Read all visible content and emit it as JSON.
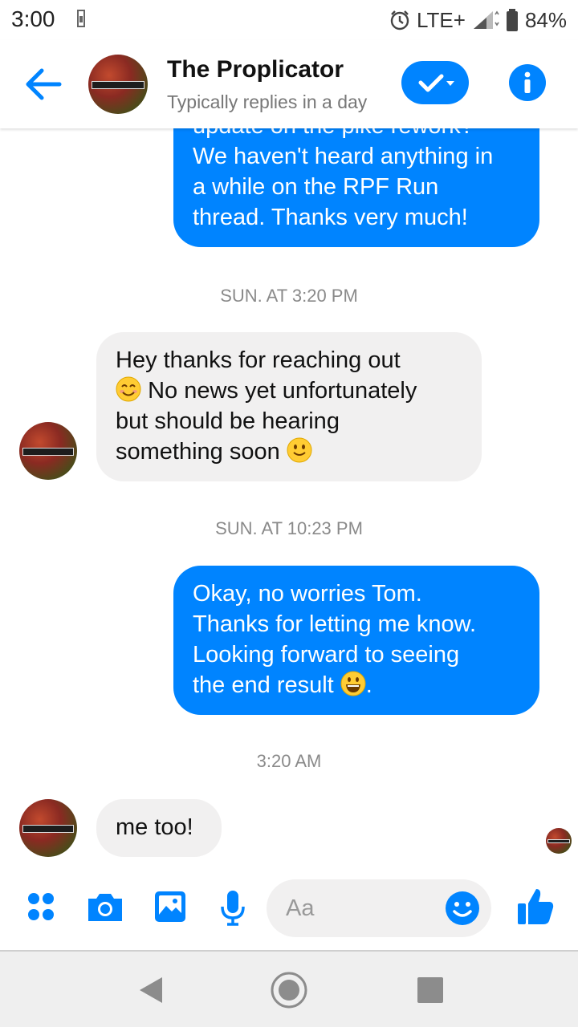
{
  "status_bar": {
    "time": "3:00",
    "network": "LTE+",
    "battery": "84%",
    "icons": [
      "sim-icon",
      "alarm-icon",
      "signal-icon",
      "battery-icon"
    ]
  },
  "header": {
    "title": "The Proplicator",
    "subtitle": "Typically replies in a day",
    "back_icon": "arrow-left-icon",
    "check_icon": "check-dropdown-icon",
    "info_icon": "info-icon",
    "avatar_text": "THE PROPLICATOR"
  },
  "messages": [
    {
      "direction": "outgoing",
      "lines": [
        "update on the pike rework?",
        "We haven't heard anything in",
        "a while on the RPF Run",
        "thread. Thanks very much!"
      ]
    },
    {
      "type": "timestamp",
      "text": "SUN. AT 3:20 PM"
    },
    {
      "direction": "incoming",
      "lines": [
        "Hey thanks for reaching out",
        "No news yet unfortunately",
        "but should be hearing",
        "something soon"
      ],
      "emojis": [
        "smiling-face-icon",
        "slightly-smiling-face-icon"
      ]
    },
    {
      "type": "timestamp",
      "text": "SUN. AT 10:23 PM"
    },
    {
      "direction": "outgoing",
      "lines": [
        "Okay, no worries Tom.",
        "Thanks for letting me know.",
        "Looking forward to seeing",
        "the end result",
        "."
      ],
      "emojis": [
        "grinning-face-icon"
      ]
    },
    {
      "type": "timestamp",
      "text": "3:20 AM"
    },
    {
      "direction": "incoming",
      "lines": [
        "me too!"
      ]
    }
  ],
  "composer": {
    "placeholder": "Aa",
    "icons": [
      "more-apps-icon",
      "camera-icon",
      "gallery-icon",
      "microphone-icon",
      "emoji-icon",
      "thumbs-up-icon"
    ]
  },
  "nav_bar": {
    "icons": [
      "back-triangle-icon",
      "home-circle-icon",
      "recents-square-icon"
    ]
  },
  "colors": {
    "accent": "#0084ff",
    "incoming_bubble": "#f1f0f0",
    "timestamp": "#8a8a8a",
    "nav_background": "#efefef"
  }
}
